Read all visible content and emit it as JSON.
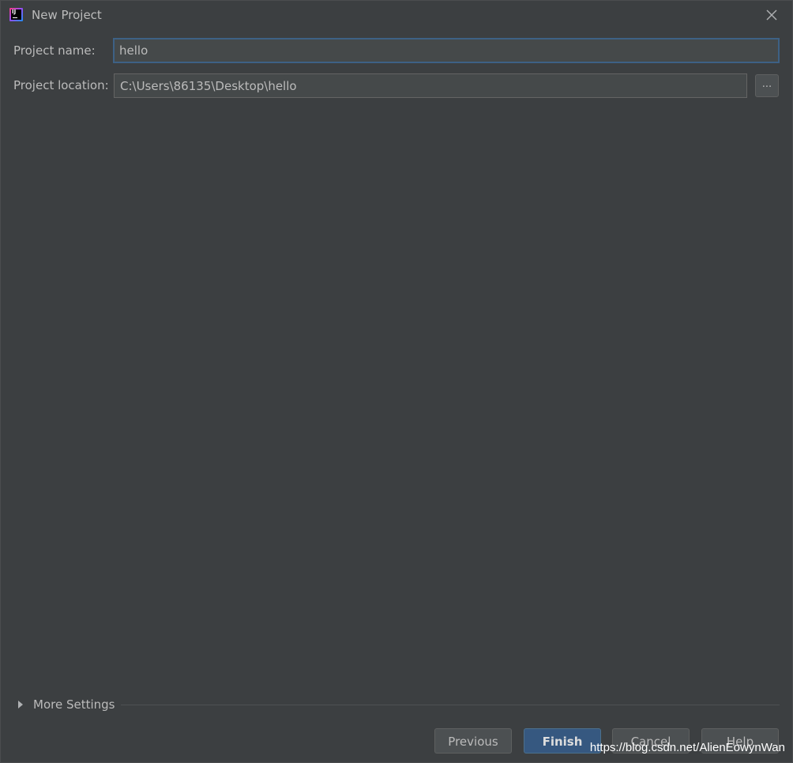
{
  "window": {
    "title": "New Project",
    "app_icon": "intellij-idea-icon"
  },
  "form": {
    "project_name_label": "Project name:",
    "project_name_value": "hello",
    "project_location_label": "Project location:",
    "project_location_value": "C:\\Users\\86135\\Desktop\\hello",
    "browse_label": "..."
  },
  "more_settings": {
    "label": "More Settings",
    "expanded": false
  },
  "buttons": {
    "previous": "Previous",
    "finish": "Finish",
    "cancel": "Cancel",
    "help": "Help"
  },
  "watermark": "https://blog.csdn.net/AlienEowynWan",
  "colors": {
    "background": "#3c3f41",
    "field_background": "#45494a",
    "focus_border": "#3d6185",
    "primary_button": "#365880",
    "text": "#bbbbbb"
  }
}
